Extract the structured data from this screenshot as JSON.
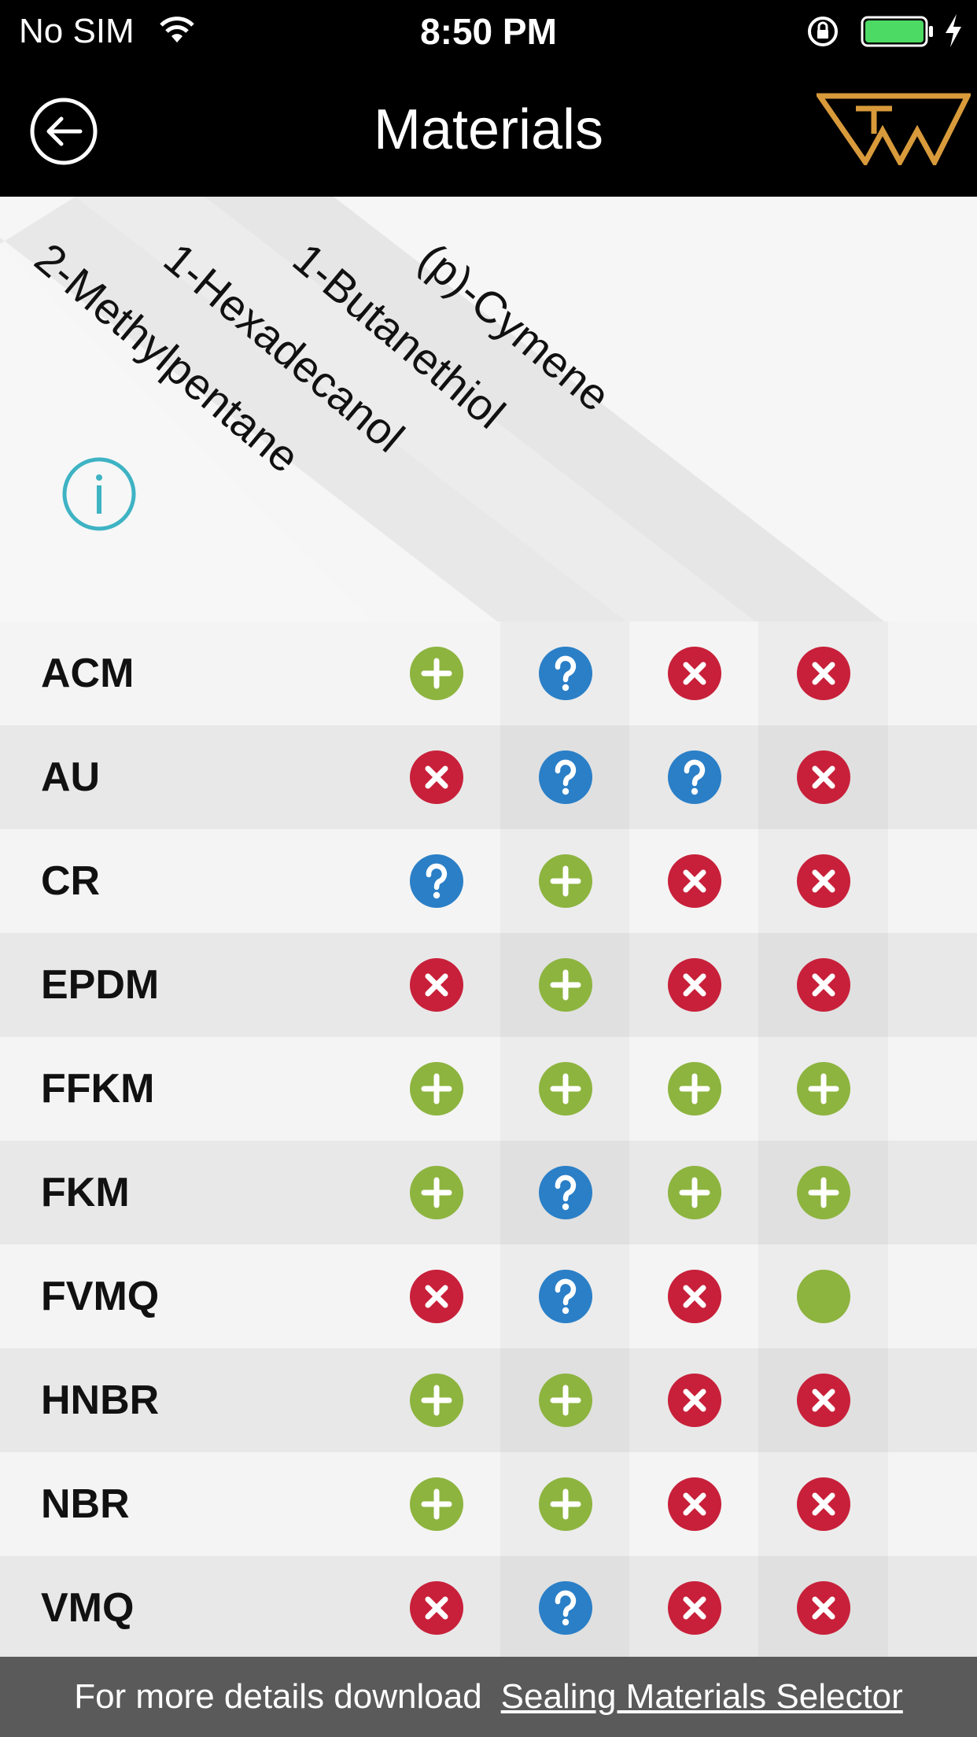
{
  "status_bar": {
    "carrier": "No SIM",
    "time": "8:50 PM",
    "battery_color": "#4cd964"
  },
  "nav": {
    "title": "Materials",
    "back_icon": "back-arrow-icon",
    "logo_icon": "brand-logo-icon",
    "logo_color": "#d89a3a"
  },
  "columns": [
    "2-Methylpentane",
    "1-Hexadecanol",
    "1-Butanethiol",
    "(p)-Cymene"
  ],
  "info_icon": "info-icon",
  "colors": {
    "plus": "#8db43f",
    "question": "#2a7fc7",
    "x": "#c8203a",
    "info": "#3eb3c4",
    "row_light": "#f4f4f4",
    "row_dark": "#e8e8e8"
  },
  "rows": [
    {
      "material": "ACM",
      "statuses": [
        "plus",
        "question",
        "x",
        "x"
      ]
    },
    {
      "material": "AU",
      "statuses": [
        "x",
        "question",
        "question",
        "x"
      ]
    },
    {
      "material": "CR",
      "statuses": [
        "question",
        "plus",
        "x",
        "x"
      ]
    },
    {
      "material": "EPDM",
      "statuses": [
        "x",
        "plus",
        "x",
        "x"
      ]
    },
    {
      "material": "FFKM",
      "statuses": [
        "plus",
        "plus",
        "plus",
        "plus"
      ]
    },
    {
      "material": "FKM",
      "statuses": [
        "plus",
        "question",
        "plus",
        "plus"
      ]
    },
    {
      "material": "FVMQ",
      "statuses": [
        "x",
        "question",
        "x",
        "dot"
      ]
    },
    {
      "material": "HNBR",
      "statuses": [
        "plus",
        "plus",
        "x",
        "x"
      ]
    },
    {
      "material": "NBR",
      "statuses": [
        "plus",
        "plus",
        "x",
        "x"
      ]
    },
    {
      "material": "VMQ",
      "statuses": [
        "x",
        "question",
        "x",
        "x"
      ]
    }
  ],
  "footer": {
    "text": "For more details download",
    "link": "Sealing Materials Selector"
  }
}
